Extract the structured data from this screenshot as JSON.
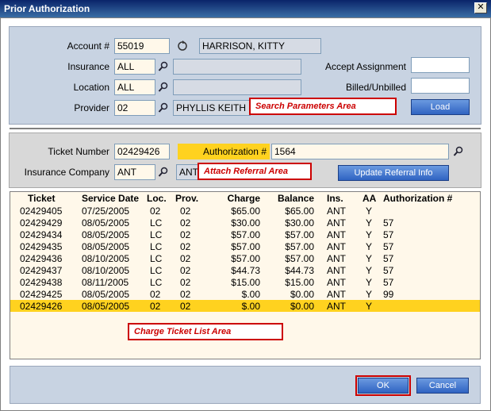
{
  "window": {
    "title": "Prior Authorization",
    "close_glyph": "✕"
  },
  "search": {
    "account_label": "Account #",
    "account_value": "55019",
    "patient_name": "HARRISON, KITTY",
    "insurance_label": "Insurance",
    "insurance_value": "ALL",
    "insurance_desc": "",
    "location_label": "Location",
    "location_value": "ALL",
    "location_desc": "",
    "provider_label": "Provider",
    "provider_value": "02",
    "provider_name": "PHYLLIS KEITH",
    "accept_assignment_label": "Accept Assignment",
    "accept_assignment_value": "",
    "billed_label": "Billed/Unbilled",
    "billed_value": "",
    "load_button": "Load",
    "callout": "Search Parameters Area"
  },
  "referral": {
    "ticket_label": "Ticket Number",
    "ticket_value": "02429426",
    "authorization_label": "Authorization #",
    "authorization_value": "1564",
    "insurance_company_label": "Insurance Company",
    "insurance_company_value": "ANT",
    "insurance_company_desc": "ANT",
    "update_button": "Update Referral Info",
    "callout": "Attach Referral Area"
  },
  "list": {
    "columns": [
      "Ticket",
      "Service Date",
      "Loc.",
      "Prov.",
      "Charge",
      "Balance",
      "Ins.",
      "AA",
      "Authorization #"
    ],
    "rows": [
      [
        "02429405",
        "07/25/2005",
        "02",
        "02",
        "$65.00",
        "$65.00",
        "ANT",
        "Y",
        ""
      ],
      [
        "02429429",
        "08/05/2005",
        "LC",
        "02",
        "$30.00",
        "$30.00",
        "ANT",
        "Y",
        "57"
      ],
      [
        "02429434",
        "08/05/2005",
        "LC",
        "02",
        "$57.00",
        "$57.00",
        "ANT",
        "Y",
        "57"
      ],
      [
        "02429435",
        "08/05/2005",
        "LC",
        "02",
        "$57.00",
        "$57.00",
        "ANT",
        "Y",
        "57"
      ],
      [
        "02429436",
        "08/10/2005",
        "LC",
        "02",
        "$57.00",
        "$57.00",
        "ANT",
        "Y",
        "57"
      ],
      [
        "02429437",
        "08/10/2005",
        "LC",
        "02",
        "$44.73",
        "$44.73",
        "ANT",
        "Y",
        "57"
      ],
      [
        "02429438",
        "08/11/2005",
        "LC",
        "02",
        "$15.00",
        "$15.00",
        "ANT",
        "Y",
        "57"
      ],
      [
        "02429425",
        "08/05/2005",
        "02",
        "02",
        "$.00",
        "$0.00",
        "ANT",
        "Y",
        "99"
      ],
      [
        "02429426",
        "08/05/2005",
        "02",
        "02",
        "$.00",
        "$0.00",
        "ANT",
        "Y",
        ""
      ]
    ],
    "selected_index": 8,
    "callout": "Charge Ticket List Area"
  },
  "footer": {
    "ok_button": "OK",
    "cancel_button": "Cancel"
  },
  "colors": {
    "highlight": "#ffd21f",
    "panel": "#c8d3e2",
    "callout": "#cc0000"
  }
}
